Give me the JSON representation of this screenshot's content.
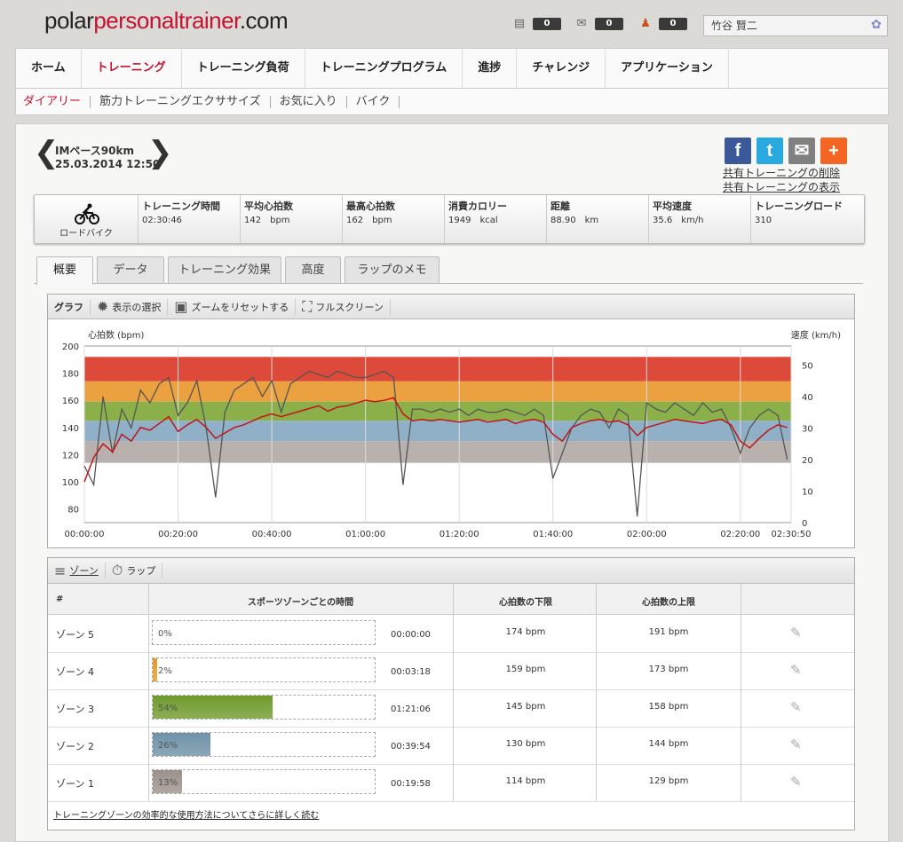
{
  "logo": {
    "part1": "polar",
    "part2": "personaltrainer",
    "part3": ".com"
  },
  "header": {
    "counters": [
      {
        "icon": "note-icon",
        "glyph": "▤",
        "value": "0"
      },
      {
        "icon": "mail-icon",
        "glyph": "✉",
        "value": "0"
      },
      {
        "icon": "user-icon",
        "glyph": "♟",
        "value": "0"
      }
    ],
    "user_name": "竹谷 賢二"
  },
  "nav": {
    "items": [
      "ホーム",
      "トレーニング",
      "トレーニング負荷",
      "トレーニングプログラム",
      "進捗",
      "チャレンジ",
      "アプリケーション"
    ],
    "active": "トレーニング"
  },
  "subnav": {
    "items": [
      "ダイアリー",
      "筋力トレーニングエクササイズ",
      "お気に入り",
      "バイク"
    ]
  },
  "session": {
    "title": "IMペース90km",
    "date": "25.03.2014 12:50",
    "prev_arrow": "❮",
    "next_arrow": "❯"
  },
  "share": {
    "buttons": [
      {
        "name": "facebook",
        "glyph": "f",
        "color": "#3b5998"
      },
      {
        "name": "twitter",
        "glyph": "t",
        "color": "#2aa9e0"
      },
      {
        "name": "email",
        "glyph": "✉",
        "color": "#808080"
      },
      {
        "name": "addthis",
        "glyph": "+",
        "color": "#f26522"
      }
    ],
    "delete_link": "共有トレーニングの削除",
    "show_link": "共有トレーニングの表示"
  },
  "summary": {
    "sport": "ロードバイク",
    "cells": [
      {
        "label": "トレーニング時間",
        "value": "02:30:46",
        "unit": ""
      },
      {
        "label": "平均心拍数",
        "value": "142",
        "unit": "bpm"
      },
      {
        "label": "最高心拍数",
        "value": "162",
        "unit": "bpm"
      },
      {
        "label": "消費カロリー",
        "value": "1949",
        "unit": "kcal"
      },
      {
        "label": "距離",
        "value": "88.90",
        "unit": "km"
      },
      {
        "label": "平均速度",
        "value": "35.6",
        "unit": "km/h"
      },
      {
        "label": "トレーニングロード",
        "value": "310",
        "unit": ""
      }
    ]
  },
  "tabs": [
    "概要",
    "データ",
    "トレーニング効果",
    "高度",
    "ラップのメモ"
  ],
  "graph_toolbar": {
    "label": "グラフ",
    "select": "表示の選択",
    "reset_zoom": "ズームをリセットする",
    "fullscreen": "フルスクリーン"
  },
  "chart_data": {
    "type": "line",
    "ylabel": "心拍数 (bpm)",
    "y2label": "速度 (km/h)",
    "ylim": [
      70,
      200
    ],
    "y2lim": [
      0,
      56
    ],
    "yticks": [
      80,
      100,
      120,
      140,
      160,
      180,
      200
    ],
    "y2ticks": [
      0,
      10,
      20,
      30,
      40,
      50
    ],
    "xticks": [
      "00:00:00",
      "00:20:00",
      "00:40:00",
      "01:00:00",
      "01:20:00",
      "01:40:00",
      "02:00:00",
      "02:20:00",
      "02:30:50"
    ],
    "xlim_min": [
      0,
      150.83
    ],
    "grid": true,
    "zones": [
      {
        "zone": 5,
        "lo": 174,
        "hi": 191,
        "color": "#de4a3a"
      },
      {
        "zone": 4,
        "lo": 159,
        "hi": 173,
        "color": "#eba13f"
      },
      {
        "zone": 3,
        "lo": 145,
        "hi": 158,
        "color": "#8bb04a"
      },
      {
        "zone": 2,
        "lo": 130,
        "hi": 144,
        "color": "#8fb0c6"
      },
      {
        "zone": 1,
        "lo": 114,
        "hi": 129,
        "color": "#b8b1ad"
      }
    ],
    "series": [
      {
        "name": "心拍数",
        "axis": "left",
        "color": "#c0151b",
        "x": [
          0,
          2,
          4,
          6,
          8,
          10,
          12,
          14,
          16,
          18,
          20,
          22,
          24,
          26,
          28,
          30,
          32,
          34,
          36,
          38,
          40,
          42,
          44,
          46,
          48,
          50,
          52,
          54,
          56,
          58,
          60,
          62,
          64,
          66,
          68,
          70,
          72,
          74,
          76,
          78,
          80,
          82,
          84,
          86,
          88,
          90,
          92,
          94,
          96,
          98,
          100,
          102,
          104,
          106,
          108,
          110,
          112,
          114,
          116,
          118,
          120,
          122,
          124,
          126,
          128,
          130,
          132,
          134,
          136,
          138,
          140,
          142,
          144,
          146,
          148,
          150
        ],
        "y": [
          100,
          118,
          128,
          122,
          135,
          130,
          140,
          138,
          143,
          148,
          137,
          142,
          146,
          140,
          132,
          136,
          140,
          142,
          145,
          148,
          150,
          148,
          150,
          152,
          154,
          156,
          152,
          155,
          156,
          158,
          160,
          159,
          160,
          162,
          150,
          145,
          146,
          145,
          146,
          145,
          144,
          145,
          146,
          144,
          145,
          146,
          143,
          145,
          146,
          144,
          135,
          130,
          140,
          143,
          145,
          146,
          144,
          145,
          142,
          134,
          140,
          142,
          144,
          146,
          145,
          144,
          143,
          145,
          146,
          142,
          130,
          125,
          132,
          138,
          142,
          140
        ]
      },
      {
        "name": "速度",
        "axis": "right",
        "color": "#555555",
        "x": [
          0,
          2,
          4,
          6,
          8,
          10,
          12,
          14,
          16,
          18,
          20,
          22,
          24,
          26,
          28,
          30,
          32,
          34,
          36,
          38,
          40,
          42,
          44,
          46,
          48,
          50,
          52,
          54,
          56,
          58,
          60,
          62,
          64,
          66,
          68,
          70,
          72,
          74,
          76,
          78,
          80,
          82,
          84,
          86,
          88,
          90,
          92,
          94,
          96,
          98,
          100,
          102,
          104,
          106,
          108,
          110,
          112,
          114,
          116,
          118,
          120,
          122,
          124,
          126,
          128,
          130,
          132,
          134,
          136,
          138,
          140,
          142,
          144,
          146,
          148,
          150
        ],
        "y": [
          18,
          12,
          40,
          22,
          36,
          30,
          42,
          38,
          44,
          46,
          34,
          38,
          45,
          30,
          8,
          35,
          42,
          44,
          46,
          40,
          45,
          35,
          44,
          46,
          48,
          47,
          46,
          48,
          47,
          46,
          46,
          47,
          48,
          46,
          12,
          36,
          36,
          35,
          36,
          35,
          36,
          34,
          36,
          35,
          35,
          36,
          35,
          34,
          36,
          34,
          14,
          22,
          30,
          34,
          36,
          35,
          30,
          36,
          34,
          2,
          38,
          36,
          35,
          38,
          36,
          34,
          38,
          35,
          36,
          30,
          22,
          30,
          34,
          36,
          34,
          20
        ]
      }
    ]
  },
  "zone_toolbar": {
    "zones_label": "ゾーン",
    "laps_label": "ラップ"
  },
  "zone_table": {
    "headers": [
      "#",
      "スポーツゾーンごとの時間",
      "心拍数の下限",
      "心拍数の上限"
    ],
    "rows": [
      {
        "name": "ゾーン 5",
        "pct": "0%",
        "pct_value": 0,
        "time": "00:00:00",
        "lo": "174 bpm",
        "hi": "191 bpm",
        "color": "#de4a3a"
      },
      {
        "name": "ゾーン 4",
        "pct": "2%",
        "pct_value": 2,
        "time": "00:03:18",
        "lo": "159 bpm",
        "hi": "173 bpm",
        "color": "#e59a2c"
      },
      {
        "name": "ゾーン 3",
        "pct": "54%",
        "pct_value": 54,
        "time": "01:21:06",
        "lo": "145 bpm",
        "hi": "158 bpm",
        "color": "#6f9a2c"
      },
      {
        "name": "ゾーン 2",
        "pct": "26%",
        "pct_value": 26,
        "time": "00:39:54",
        "lo": "130 bpm",
        "hi": "144 bpm",
        "color": "#6f92a8"
      },
      {
        "name": "ゾーン 1",
        "pct": "13%",
        "pct_value": 13,
        "time": "00:19:58",
        "lo": "114 bpm",
        "hi": "129 bpm",
        "color": "#9c928c"
      }
    ],
    "footer_link": "トレーニングゾーンの効率的な使用方法についてさらに詳しく読む"
  }
}
